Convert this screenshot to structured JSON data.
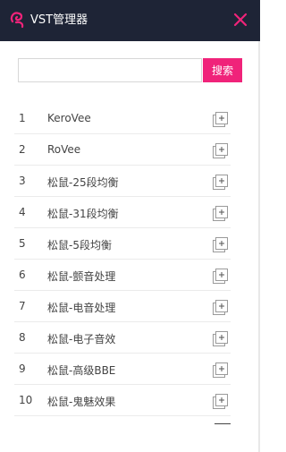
{
  "app": {
    "title": "VST管理器"
  },
  "search": {
    "placeholder": "",
    "button_label": "搜索"
  },
  "items": [
    {
      "num": "1",
      "name": "KeroVee"
    },
    {
      "num": "2",
      "name": "RoVee"
    },
    {
      "num": "3",
      "name": "松鼠-25段均衡"
    },
    {
      "num": "4",
      "name": "松鼠-31段均衡"
    },
    {
      "num": "5",
      "name": "松鼠-5段均衡"
    },
    {
      "num": "6",
      "name": "松鼠-颤音处理"
    },
    {
      "num": "7",
      "name": "松鼠-电音处理"
    },
    {
      "num": "8",
      "name": "松鼠-电子音效"
    },
    {
      "num": "9",
      "name": "松鼠-高级BBE"
    },
    {
      "num": "10",
      "name": "松鼠-鬼魅效果"
    }
  ],
  "colors": {
    "titlebar": "#1e2436",
    "accent": "#f0237a"
  },
  "icons": {
    "logo": "app-logo-icon",
    "close": "close-icon",
    "add": "add-plugin-icon"
  }
}
